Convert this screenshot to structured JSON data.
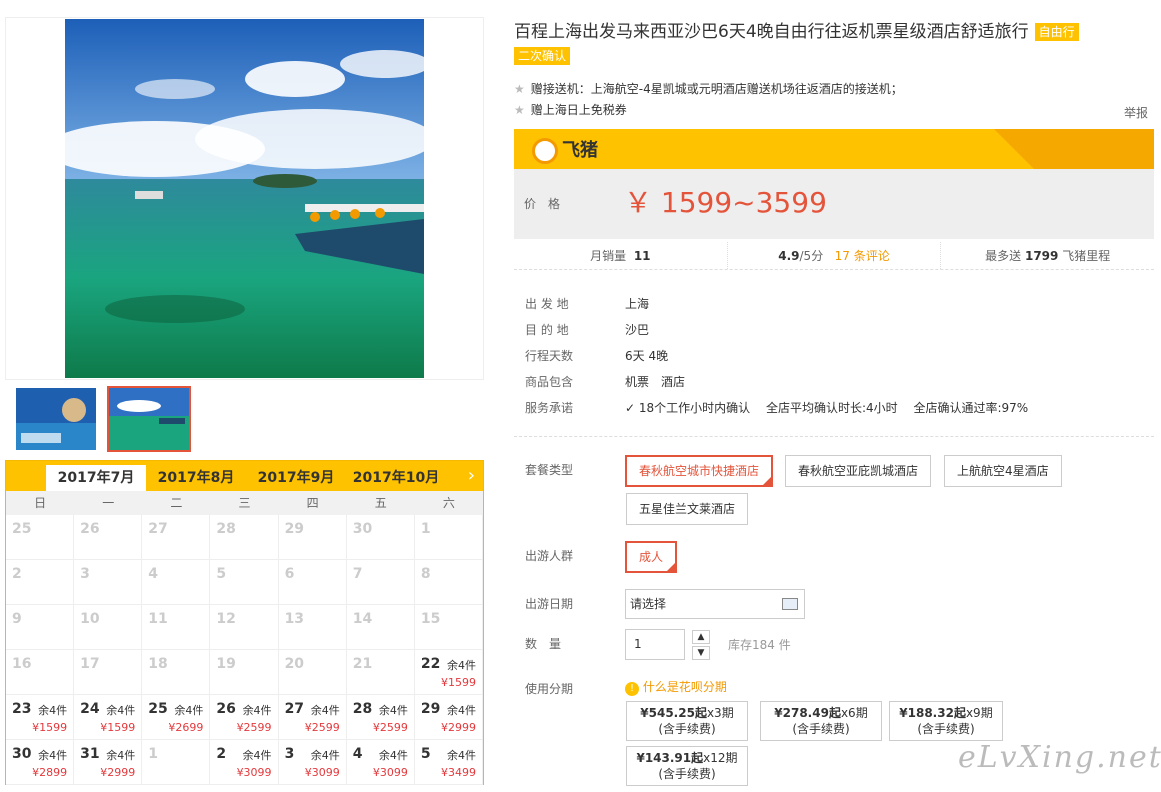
{
  "title": "百程上海出发马来西亚沙巴6天4晚自由行往返机票星级酒店舒适旅行",
  "tags": [
    "自由行",
    "二次确认"
  ],
  "promos": [
    "赠接送机：上海航空-4星凯城或元明酒店赠送机场往返酒店的接送机；",
    "赠上海日上免税券"
  ],
  "report": "举报",
  "brand": "飞猪",
  "price_label": "价　格",
  "price": "￥ 1599~3599",
  "stats": {
    "monthly_sales_label": "月销量",
    "monthly_sales": "11",
    "rating": "4.9",
    "rating_max": "/5分",
    "reviews": "17 条评论",
    "miles_prefix": "最多送",
    "miles": "1799",
    "miles_suffix": "飞猪里程"
  },
  "info": [
    {
      "label": "出 发 地",
      "value": "上海"
    },
    {
      "label": "目 的 地",
      "value": "沙巴"
    },
    {
      "label": "行程天数",
      "value": "6天 4晚"
    },
    {
      "label": "商品包含",
      "value": "机票　酒店"
    },
    {
      "label": "服务承诺",
      "value": "18个工作小时内确认　 全店平均确认时长:4小时　 全店确认通过率:97%"
    }
  ],
  "package_label": "套餐类型",
  "packages": [
    "春秋航空城市快捷酒店",
    "春秋航空亚庇凯城酒店",
    "上航航空4星酒店",
    "五星佳兰文莱酒店"
  ],
  "traveler_label": "出游人群",
  "traveler": "成人",
  "date_label": "出游日期",
  "date_placeholder": "请选择",
  "qty_label": "数　量",
  "qty": "1",
  "stock": "库存184 件",
  "installment_label": "使用分期",
  "installment_link": "什么是花呗分期",
  "installments": [
    {
      "amount": "¥545.25起",
      "period": "x3期",
      "fee": "(含手续费)"
    },
    {
      "amount": "¥278.49起",
      "period": "x6期",
      "fee": "(含手续费)"
    },
    {
      "amount": "¥188.32起",
      "period": "x9期",
      "fee": "(含手续费)"
    },
    {
      "amount": "¥143.91起",
      "period": "x12期",
      "fee": "(含手续费)"
    }
  ],
  "calendar": {
    "months": [
      "2017年7月",
      "2017年8月",
      "2017年9月",
      "2017年10月"
    ],
    "weekdays": [
      "日",
      "一",
      "二",
      "三",
      "四",
      "五",
      "六"
    ],
    "cells": [
      {
        "d": "25"
      },
      {
        "d": "26"
      },
      {
        "d": "27"
      },
      {
        "d": "28"
      },
      {
        "d": "29"
      },
      {
        "d": "30"
      },
      {
        "d": "1"
      },
      {
        "d": "2"
      },
      {
        "d": "3"
      },
      {
        "d": "4"
      },
      {
        "d": "5"
      },
      {
        "d": "6"
      },
      {
        "d": "7"
      },
      {
        "d": "8"
      },
      {
        "d": "9"
      },
      {
        "d": "10"
      },
      {
        "d": "11"
      },
      {
        "d": "12"
      },
      {
        "d": "13"
      },
      {
        "d": "14"
      },
      {
        "d": "15"
      },
      {
        "d": "16"
      },
      {
        "d": "17"
      },
      {
        "d": "18"
      },
      {
        "d": "19"
      },
      {
        "d": "20"
      },
      {
        "d": "21"
      },
      {
        "d": "22",
        "s": "余4件",
        "p": "¥1599"
      },
      {
        "d": "23",
        "s": "余4件",
        "p": "¥1599"
      },
      {
        "d": "24",
        "s": "余4件",
        "p": "¥1599"
      },
      {
        "d": "25",
        "s": "余4件",
        "p": "¥2699"
      },
      {
        "d": "26",
        "s": "余4件",
        "p": "¥2599"
      },
      {
        "d": "27",
        "s": "余4件",
        "p": "¥2599"
      },
      {
        "d": "28",
        "s": "余4件",
        "p": "¥2599"
      },
      {
        "d": "29",
        "s": "余4件",
        "p": "¥2999"
      },
      {
        "d": "30",
        "s": "余4件",
        "p": "¥2899"
      },
      {
        "d": "31",
        "s": "余4件",
        "p": "¥2999"
      },
      {
        "d": "1"
      },
      {
        "d": "2",
        "s": "余4件",
        "p": "¥3099"
      },
      {
        "d": "3",
        "s": "余4件",
        "p": "¥3099"
      },
      {
        "d": "4",
        "s": "余4件",
        "p": "¥3099"
      },
      {
        "d": "5",
        "s": "余4件",
        "p": "¥3499"
      }
    ]
  },
  "watermark": "eLvXing.net"
}
